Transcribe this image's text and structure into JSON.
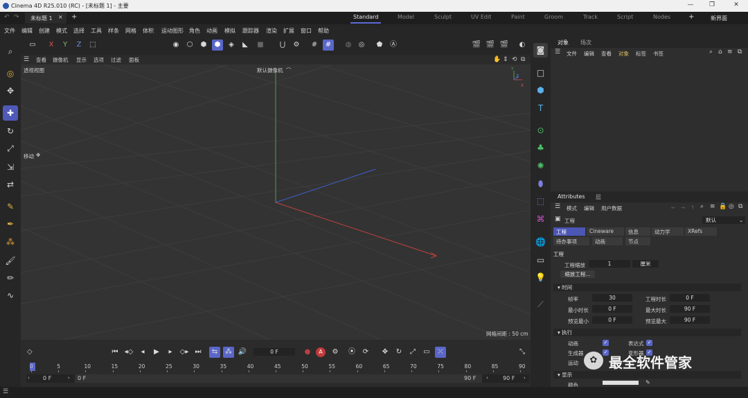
{
  "titlebar": {
    "title": "Cinema 4D R25.010 (RC) - [未标题 1] - 主要",
    "min": "—",
    "max": "❐",
    "close": "✕"
  },
  "tabs": {
    "doc_tab": "未标题 1",
    "doc_tab_close": "×",
    "add": "+",
    "workspaces": [
      "Standard",
      "Model",
      "Sculpt",
      "UV Edit",
      "Paint",
      "Groom",
      "Track",
      "Script",
      "Nodes"
    ],
    "new_layout": "新界面"
  },
  "menubar": [
    "文件",
    "编辑",
    "创建",
    "模式",
    "选择",
    "工具",
    "样条",
    "网格",
    "体积",
    "运动图形",
    "角色",
    "动画",
    "模拟",
    "跟踪器",
    "渲染",
    "扩展",
    "窗口",
    "帮助"
  ],
  "axis_buttons": {
    "x": "X",
    "y": "Y",
    "z": "Z"
  },
  "viewport": {
    "menu": [
      "查看",
      "摄像机",
      "显示",
      "选项",
      "过滤",
      "面板"
    ],
    "view_name": "透视视图",
    "camera": "默认摄像机",
    "tool_hint": "移动",
    "grid_spacing": "网格间距 : 50 cm",
    "axis_labels": {
      "y": "Y",
      "z": "Z",
      "x": "X"
    }
  },
  "object_panel": {
    "tabs": [
      "对象",
      "场次"
    ],
    "menu": [
      "文件",
      "编辑",
      "查看",
      "对象",
      "标签",
      "书签"
    ]
  },
  "attributes": {
    "tabs": [
      "Attributes",
      "层"
    ],
    "menu": [
      "模式",
      "编辑",
      "用户数据"
    ],
    "object": "工程",
    "preset": "默认",
    "subtabs_row1": [
      "工程",
      "Cineware",
      "信息",
      "动力学",
      "XRefs"
    ],
    "subtabs_row2": [
      "待办事项",
      "动画",
      "节点"
    ],
    "section_title": "工程",
    "project_scale_label": "工程缩放",
    "project_scale_value": "1",
    "project_scale_unit": "厘米",
    "scale_button": "缩放工程...",
    "time_section": "时间",
    "fps_label": "帧率",
    "fps_value": "30",
    "proj_len_label": "工程时长",
    "proj_len_value": "0 F",
    "min_len_label": "最小时长",
    "min_len_value": "0 F",
    "max_len_label": "最大时长",
    "max_len_value": "90 F",
    "prev_min_label": "预览最小",
    "prev_min_value": "0 F",
    "prev_max_label": "预览最大",
    "prev_max_value": "90 F",
    "exec_section": "执行",
    "anim_label": "动画",
    "expr_label": "表达式",
    "gen_label": "生成器",
    "deform_label": "变形器",
    "motion_label": "运动",
    "display_section": "显示",
    "color_label": "颜色"
  },
  "timeline": {
    "current_frame": "0 F",
    "ticks": [
      "0",
      "5",
      "10",
      "15",
      "20",
      "25",
      "30",
      "35",
      "40",
      "45",
      "50",
      "55",
      "60",
      "65",
      "70",
      "75",
      "80",
      "85",
      "90"
    ],
    "start": "0 F",
    "start2": "0 F",
    "end": "90 F",
    "end2": "90 F"
  },
  "watermark": "最全软件管家",
  "colors": {
    "accent": "#5a66c8",
    "x_axis": "#c44040",
    "y_axis": "#4ea050",
    "z_axis": "#3d5fd0"
  }
}
